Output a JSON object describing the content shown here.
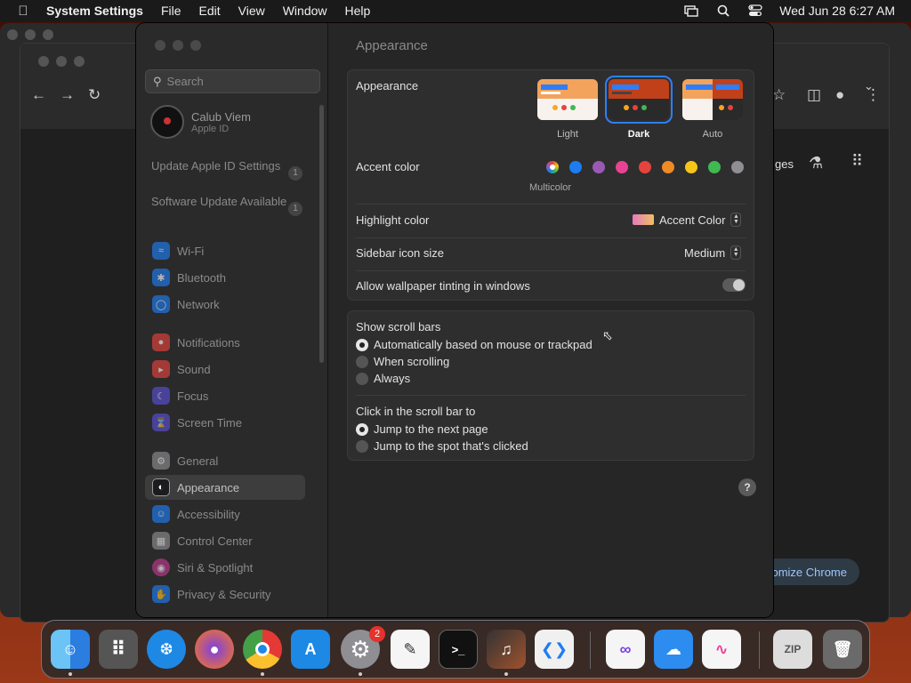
{
  "menubar": {
    "app_name": "System Settings",
    "items": [
      "File",
      "Edit",
      "View",
      "Window",
      "Help"
    ],
    "clock": "Wed Jun 28  6:27 AM"
  },
  "chrome": {
    "partial_label": "ges",
    "customize_label": "ustomize Chrome"
  },
  "sidebar": {
    "search_placeholder": "Search",
    "account_name": "Calub Viem",
    "account_sub": "Apple ID",
    "updates": [
      {
        "label": "Update Apple ID Settings",
        "count": "1"
      },
      {
        "label": "Software Update Available",
        "count": "1"
      }
    ],
    "items": [
      {
        "label": "Wi-Fi",
        "icon": "wifi-icon",
        "color": "#1e7cf2"
      },
      {
        "label": "Bluetooth",
        "icon": "bluetooth-icon",
        "color": "#1e7cf2"
      },
      {
        "label": "Network",
        "icon": "globe-icon",
        "color": "#1e7cf2"
      },
      {
        "label": "Notifications",
        "icon": "bell-icon",
        "color": "#e5433d"
      },
      {
        "label": "Sound",
        "icon": "speaker-icon",
        "color": "#e5433d"
      },
      {
        "label": "Focus",
        "icon": "moon-icon",
        "color": "#5b4fd6"
      },
      {
        "label": "Screen Time",
        "icon": "hourglass-icon",
        "color": "#5b4fd6"
      },
      {
        "label": "General",
        "icon": "gear-icon",
        "color": "#8e8e93"
      },
      {
        "label": "Appearance",
        "icon": "appearance-icon",
        "color": "#1c1c1e"
      },
      {
        "label": "Accessibility",
        "icon": "accessibility-icon",
        "color": "#1e7cf2"
      },
      {
        "label": "Control Center",
        "icon": "control-center-icon",
        "color": "#8e8e93"
      },
      {
        "label": "Siri & Spotlight",
        "icon": "siri-icon",
        "color": "#c0398f"
      },
      {
        "label": "Privacy & Security",
        "icon": "hand-icon",
        "color": "#1e7cf2"
      }
    ],
    "active": "Appearance"
  },
  "content": {
    "title": "Appearance",
    "appearance": {
      "label": "Appearance",
      "options": [
        "Light",
        "Dark",
        "Auto"
      ],
      "selected": "Dark"
    },
    "accent": {
      "label": "Accent color",
      "colors": [
        "#ffffff",
        "#1e7cf2",
        "#9b59b6",
        "#e84393",
        "#e5433d",
        "#f08a24",
        "#f5c518",
        "#3fb950",
        "#8e8e93"
      ],
      "selected_label": "Multicolor"
    },
    "highlight": {
      "label": "Highlight color",
      "value": "Accent Color"
    },
    "sidebar_icon": {
      "label": "Sidebar icon size",
      "value": "Medium"
    },
    "wallpaper_tint": {
      "label": "Allow wallpaper tinting in windows",
      "enabled": false
    },
    "scroll_bars": {
      "label": "Show scroll bars",
      "options": [
        "Automatically based on mouse or trackpad",
        "When scrolling",
        "Always"
      ],
      "selected": 0
    },
    "click_scroll": {
      "label": "Click in the scroll bar to",
      "options": [
        "Jump to the next page",
        "Jump to the spot that's clicked"
      ],
      "selected": 0
    },
    "help_label": "?"
  },
  "dock": {
    "apps": [
      "Finder",
      "Launchpad",
      "Safari",
      "Firefox",
      "Chrome",
      "App Store",
      "System Settings",
      "TextEdit",
      "Terminal",
      "GarageBand",
      "VS Code",
      "Visual Studio",
      "iCloud Weather",
      "Freeform",
      "Archive Utility",
      "Trash"
    ],
    "settings_badge": "2"
  }
}
